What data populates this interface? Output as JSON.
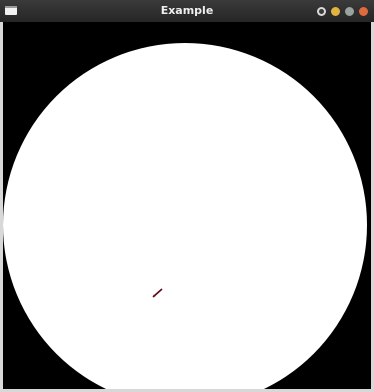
{
  "window": {
    "title": "Example",
    "icons": {
      "app": "window-icon",
      "restore": "restore-icon",
      "minimize": "minimize-icon",
      "maximize": "maximize-icon",
      "close": "close-icon"
    },
    "colors": {
      "titlebar": "#2e2e2e",
      "minimize": "#e3b341",
      "maximize": "#9aa39f",
      "close": "#e06a3c"
    }
  },
  "canvas": {
    "background_color": "#000000",
    "shape": "circle",
    "shape_color": "#ffffff",
    "pointer_icon": "pen-cursor-icon"
  }
}
